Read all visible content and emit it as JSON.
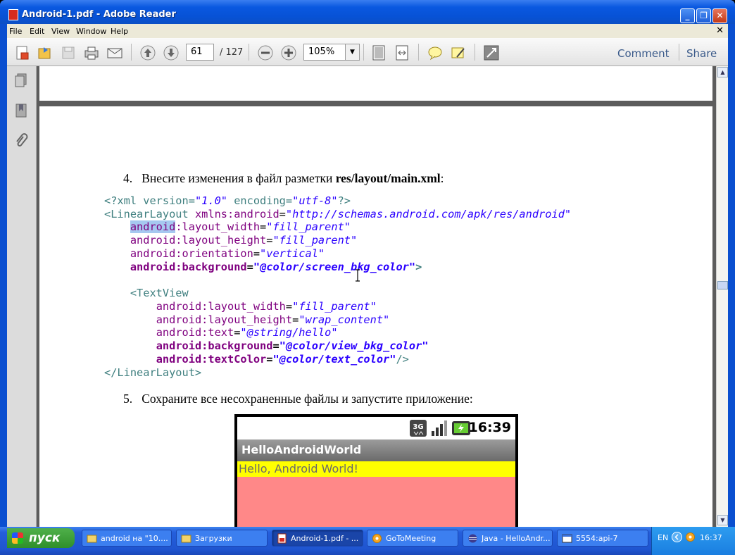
{
  "window": {
    "title": "Android-1.pdf - Adobe Reader",
    "minimize": "_",
    "maximize": "❐",
    "close": "✕"
  },
  "menu": {
    "items": [
      "File",
      "Edit",
      "View",
      "Window",
      "Help"
    ],
    "close_doc": "✕"
  },
  "toolbar": {
    "page_current": "61",
    "page_total": "/ 127",
    "zoom": "105%",
    "comment": "Comment",
    "share": "Share"
  },
  "document": {
    "step4": {
      "number": "4.",
      "text": "Внесите изменения в файл разметки ",
      "bold": "res/layout/main.xml",
      "suffix": ":"
    },
    "code": {
      "l1_a": "<?xml version=",
      "l1_b": "\"1.0\"",
      "l1_c": " encoding=",
      "l1_d": "\"utf-8\"",
      "l1_e": "?>",
      "l2_a": "<LinearLayout",
      "l2_b": " xmlns:android",
      "l2_c": "=",
      "l2_d": "\"http://schemas.android.com/apk/res/android\"",
      "l3_a": "android",
      "l3_b": ":layout_width",
      "l3_c": "=",
      "l3_d": "\"fill_parent\"",
      "l4_a": "android:layout_height",
      "l4_b": "=",
      "l4_c": "\"fill_parent\"",
      "l5_a": "android:orientation",
      "l5_b": "=",
      "l5_c": "\"vertical\"",
      "l6_a": "android:background",
      "l6_b": "=",
      "l6_c": "\"@color/screen_bkg_color\"",
      "l6_d": ">",
      "l7_a": "<TextView",
      "l8_a": "android:layout_width",
      "l8_b": "=",
      "l8_c": "\"fill_parent\"",
      "l9_a": "android:layout_height",
      "l9_b": "=",
      "l9_c": "\"wrap_content\"",
      "l10_a": "android:text",
      "l10_b": "=",
      "l10_c": "\"@string/hello\"",
      "l11_a": "android:background",
      "l11_b": "=",
      "l11_c": "\"@color/view_bkg_color\"",
      "l12_a": "android:textColor",
      "l12_b": "=",
      "l12_c": "\"@color/text_color\"",
      "l12_d": "/>",
      "l13_a": "</LinearLayout>"
    },
    "step5": {
      "number": "5.",
      "text": "Сохраните все несохраненные файлы и запустите приложение:"
    },
    "phone": {
      "network": "3G",
      "time": "16:39",
      "app_title": "HelloAndroidWorld",
      "hello_text": "Hello, Android World!"
    }
  },
  "taskbar": {
    "start_label": "пуск",
    "tasks": [
      {
        "label": "android на \"10...."
      },
      {
        "label": "Загрузки"
      },
      {
        "label": "Android-1.pdf - ..."
      },
      {
        "label": "GoToMeeting"
      },
      {
        "label": "Java - HelloAndr..."
      },
      {
        "label": "5554:api-7"
      }
    ],
    "lang": "EN",
    "time": "16:37"
  }
}
